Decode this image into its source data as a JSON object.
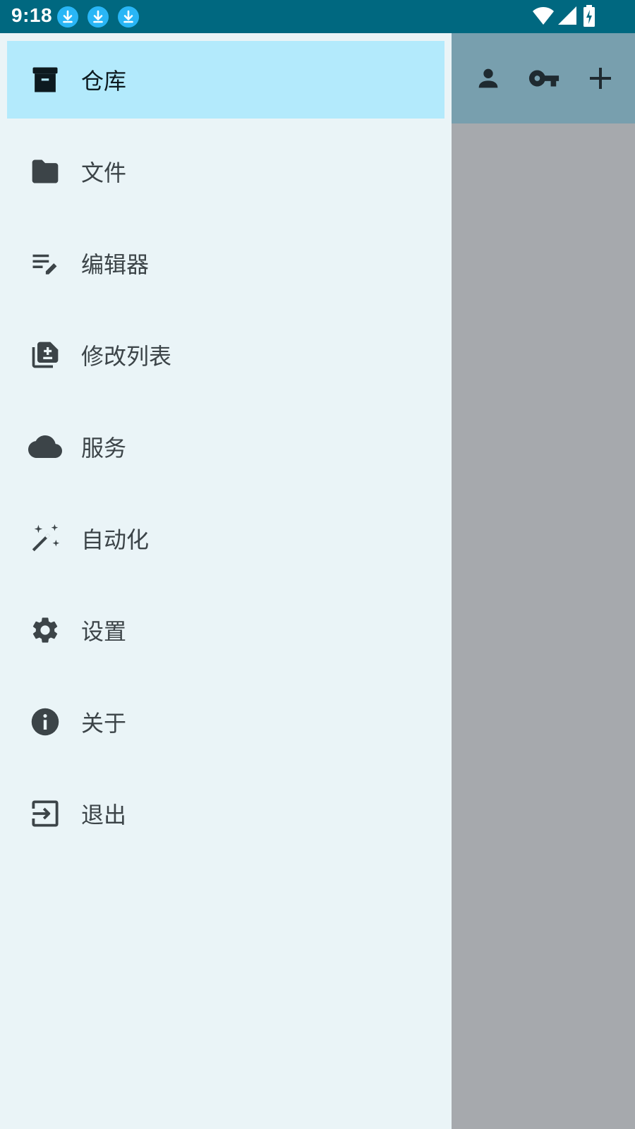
{
  "status_bar": {
    "time": "9:18",
    "notification_icons": [
      "download-icon",
      "download-icon",
      "download-icon"
    ],
    "system_icons": [
      "wifi-icon",
      "signal-icon",
      "battery-charging-icon"
    ]
  },
  "app_bar": {
    "actions": [
      "account-icon",
      "key-icon",
      "add-icon"
    ]
  },
  "drawer": {
    "items": [
      {
        "label": "仓库",
        "icon": "archive-icon",
        "active": true
      },
      {
        "label": "文件",
        "icon": "folder-icon",
        "active": false
      },
      {
        "label": "编辑器",
        "icon": "edit-note-icon",
        "active": false
      },
      {
        "label": "修改列表",
        "icon": "library-add-icon",
        "active": false
      },
      {
        "label": "服务",
        "icon": "cloud-icon",
        "active": false
      },
      {
        "label": "自动化",
        "icon": "magic-wand-icon",
        "active": false
      },
      {
        "label": "设置",
        "icon": "settings-icon",
        "active": false
      },
      {
        "label": "关于",
        "icon": "info-icon",
        "active": false
      },
      {
        "label": "退出",
        "icon": "exit-icon",
        "active": false
      }
    ]
  },
  "colors": {
    "status_bar": "#006880",
    "app_bar": "#789FAE",
    "drawer_bg": "#EAF4F7",
    "active_item_bg": "#B3EAFC",
    "notification_badge": "#29B6F6",
    "icon": "#3C4448",
    "scrim": "#A6A9AD"
  }
}
